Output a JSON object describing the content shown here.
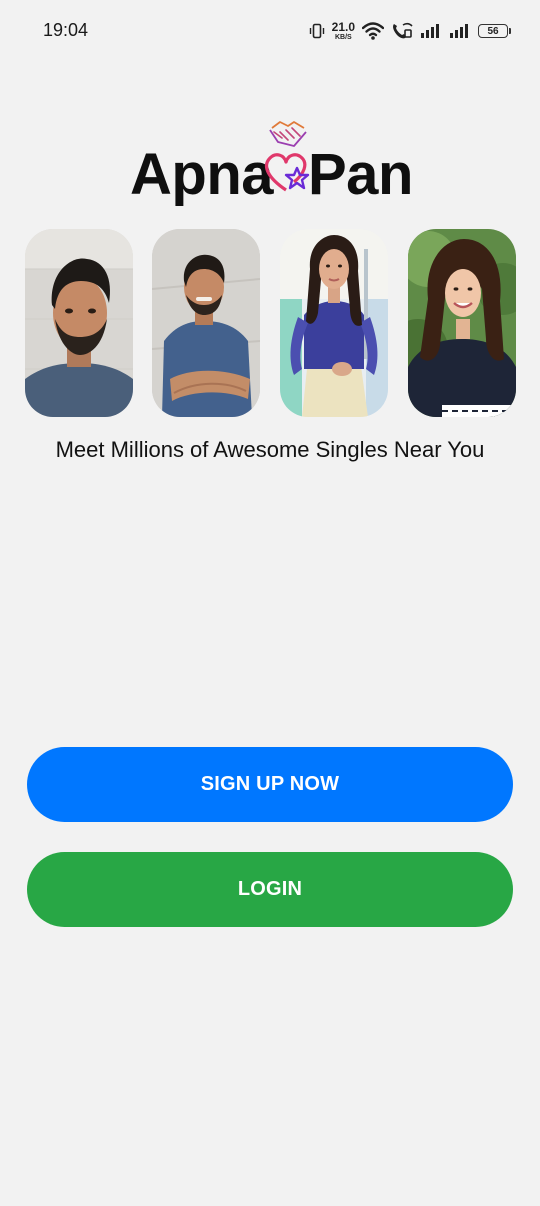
{
  "status_bar": {
    "time": "19:04",
    "net_speed_value": "21.0",
    "net_speed_unit": "KB/S",
    "battery": "56",
    "icons": [
      "vibrate-icon",
      "wifi-icon",
      "wifi-calling-icon",
      "signal-icon",
      "signal-icon"
    ]
  },
  "logo": {
    "left_text": "Apna",
    "right_text": "Pan",
    "mark_icon": "handshake-heart-star-icon"
  },
  "photos": [
    {
      "name": "profile-photo-1",
      "description_icon": "man-portrait"
    },
    {
      "name": "profile-photo-2",
      "description_icon": "man-portrait"
    },
    {
      "name": "profile-photo-3",
      "description_icon": "woman-portrait"
    },
    {
      "name": "profile-photo-4",
      "description_icon": "woman-portrait"
    }
  ],
  "tagline": "Meet Millions of Awesome Singles Near You",
  "buttons": {
    "signup_label": "SIGN UP NOW",
    "login_label": "LOGIN"
  },
  "colors": {
    "background": "#f2f2f2",
    "signup": "#0077ff",
    "login": "#28a745",
    "logo_heart": "#e0386b",
    "logo_star": "#6a2bd6"
  }
}
